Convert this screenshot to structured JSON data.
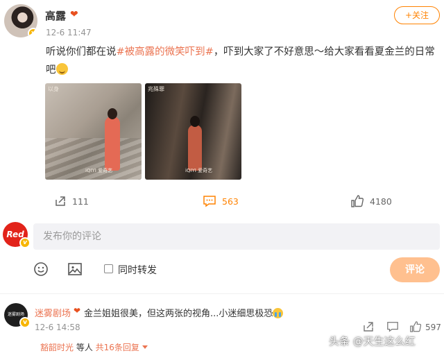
{
  "post": {
    "author": "高露",
    "author_emoji": "❤",
    "time": "12-6 11:47",
    "follow_label": "+关注",
    "text_before": "听说你们都在说",
    "hashtag": "#被高露的微笑吓到#",
    "text_after": "，吓到大家了不好意思～给大家看看夏金兰的日常吧",
    "images": [
      {
        "caption": "以身",
        "watermark": "iQIYI 爱奇艺"
      },
      {
        "caption": "兆殊罪",
        "watermark": "iQIYI 爱奇艺"
      }
    ]
  },
  "actions": {
    "repost_count": "111",
    "comment_count": "563",
    "like_count": "4180",
    "comment_color": "#ff8200"
  },
  "composer": {
    "avatar_text": "Red",
    "placeholder": "发布你的评论",
    "forward_label": "同时转发",
    "submit_label": "评论"
  },
  "comment": {
    "avatar_text": "迷雾剧场",
    "user": "迷雾剧场",
    "emoji": "❤",
    "text": "金兰姐姐很美，但这两张的视角...小迷细思极恐",
    "time": "12-6 14:58",
    "likes": "597",
    "reply_name": "豁韶时光",
    "reply_mid": " 等人 ",
    "reply_total": "共16条回复"
  },
  "watermark": "头条 @天生这么红",
  "icons": [
    "repost-icon",
    "comment-icon",
    "like-icon",
    "emoji-icon",
    "image-icon",
    "verified-icon"
  ]
}
